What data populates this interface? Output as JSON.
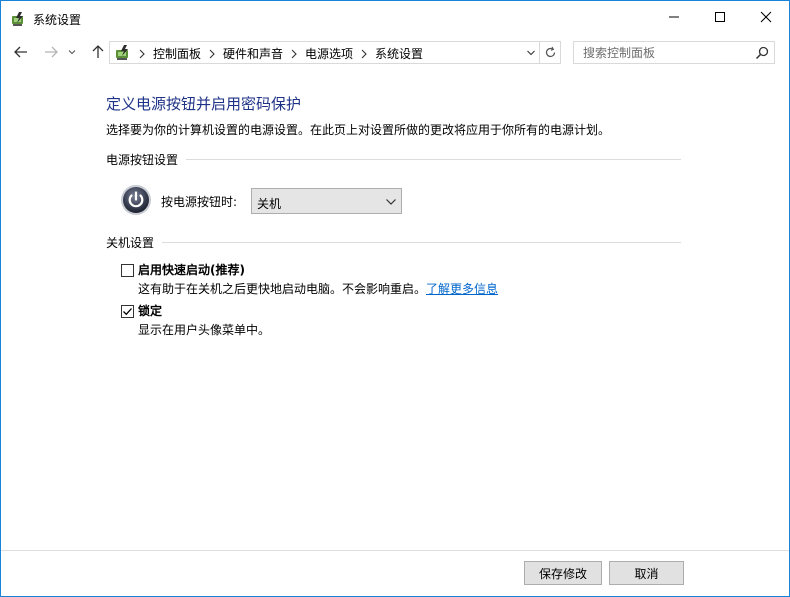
{
  "window": {
    "title": "系统设置",
    "icons": {
      "app": "power-options-icon",
      "minimize": "minimize-icon",
      "maximize": "maximize-icon",
      "close": "close-icon"
    }
  },
  "nav": {
    "icons": {
      "back": "arrow-left-icon",
      "forward": "arrow-right-icon",
      "recent": "chevron-down-icon",
      "up": "arrow-up-icon",
      "refresh": "refresh-icon"
    },
    "breadcrumbs": [
      "控制面板",
      "硬件和声音",
      "电源选项",
      "系统设置"
    ],
    "search_placeholder": "搜索控制面板"
  },
  "content": {
    "heading": "定义电源按钮并启用密码保护",
    "description": "选择要为你的计算机设置的电源设置。在此页上对设置所做的更改将应用于你所有的电源计划。",
    "power_section": {
      "label": "电源按钮设置",
      "button_label": "按电源按钮时:",
      "selected": "关机"
    },
    "shutdown_section": {
      "label": "关机设置",
      "fast_startup": {
        "title": "启用快速启动(推荐)",
        "description": "这有助于在关机之后更快地启动电脑。不会影响重启。",
        "link": "了解更多信息",
        "checked": false
      },
      "lock": {
        "title": "锁定",
        "description": "显示在用户头像菜单中。",
        "checked": true
      }
    }
  },
  "footer": {
    "save_label": "保存修改",
    "cancel_label": "取消"
  },
  "colors": {
    "heading": "#1e3287",
    "link": "#0066cc",
    "window_border": "#1883d7"
  }
}
